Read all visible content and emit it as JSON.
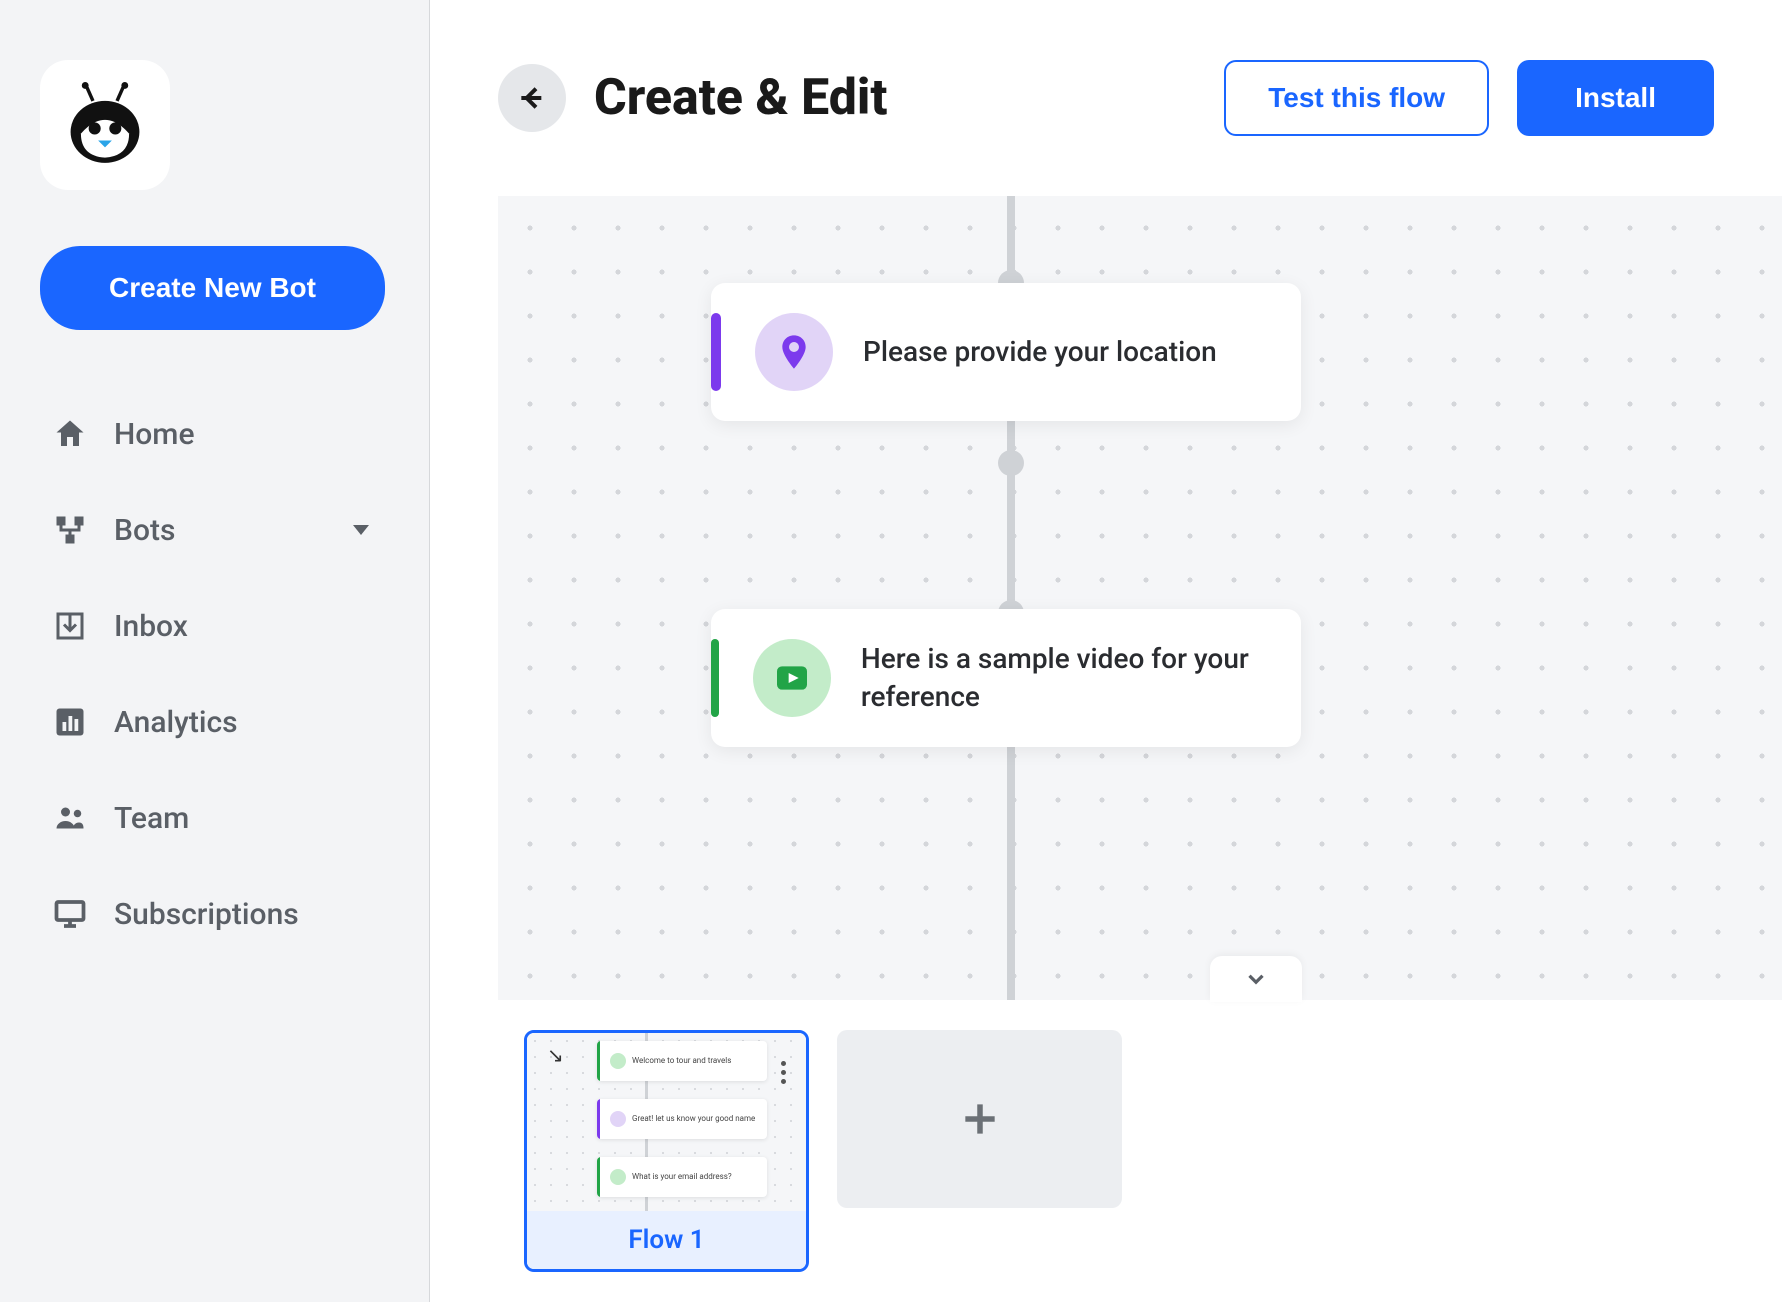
{
  "sidebar": {
    "create_button": "Create New Bot",
    "items": [
      {
        "label": "Home"
      },
      {
        "label": "Bots"
      },
      {
        "label": "Inbox"
      },
      {
        "label": "Analytics"
      },
      {
        "label": "Team"
      },
      {
        "label": "Subscriptions"
      }
    ]
  },
  "header": {
    "title": "Create & Edit",
    "test_button": "Test this flow",
    "install_button": "Install"
  },
  "canvas": {
    "cards": [
      {
        "text": "Please provide your location"
      },
      {
        "text": "Here is a sample video for your reference"
      }
    ]
  },
  "flows": {
    "active_label": "Flow 1",
    "mini_cards": [
      {
        "text": "Welcome to tour and travels"
      },
      {
        "text": "Great! let us know your good name"
      },
      {
        "text": "What is your email address?"
      }
    ]
  },
  "colors": {
    "primary": "#1a66ff",
    "purple": "#7c3aed",
    "green": "#22a447"
  }
}
